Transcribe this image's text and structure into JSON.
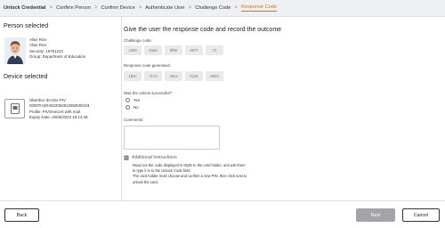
{
  "breadcrumb": {
    "items": [
      "Unlock Credential",
      "Confirm Person",
      "Confirm Device",
      "Authenticate User",
      "Challenge Code",
      "Response Code"
    ],
    "separator": ">"
  },
  "person": {
    "section_title": "Person selected",
    "lines": [
      "Alise Rice",
      "Alise Rice",
      "Security: 19761223",
      "Group: Department of Education"
    ]
  },
  "device": {
    "section_title": "Device selected",
    "lines": [
      "Oberthur ID-One PIV",
      "0000TrU(R4022052812550000101",
      "Profile: PIVOneCert with mail",
      "Expiry Date: 20/06/2024 15:14:49"
    ]
  },
  "main": {
    "title": "Give the user the response code and record the outcome",
    "challenge_label": "Challenge code:",
    "challenge_codes": [
      "1366",
      "83a5",
      "8f86",
      "4677",
      "72"
    ],
    "response_label": "Response code generated:",
    "response_codes": [
      "1b0c",
      "7173",
      "48ca",
      "0115",
      "6833"
    ],
    "unlock_question": "Was the unlock successful?",
    "unlock_options": [
      "Yes",
      "No"
    ],
    "comments_label": "Comments:",
    "comments_value": "",
    "additional_title": "Additional Instructions",
    "instructions": [
      "Read out the code displayed in MyID to the card holder, and ask them",
      "to type it in to the Unlock Code field.",
      "The card holder must choose and confirm a new PIN, then click next to",
      "unlock the card."
    ]
  },
  "footer": {
    "back_label": "Back",
    "next_label": "Next",
    "cancel_label": "Cancel"
  },
  "colors": {
    "active_crumb": "#c97a1d",
    "next_button": "#a3a3aa"
  }
}
